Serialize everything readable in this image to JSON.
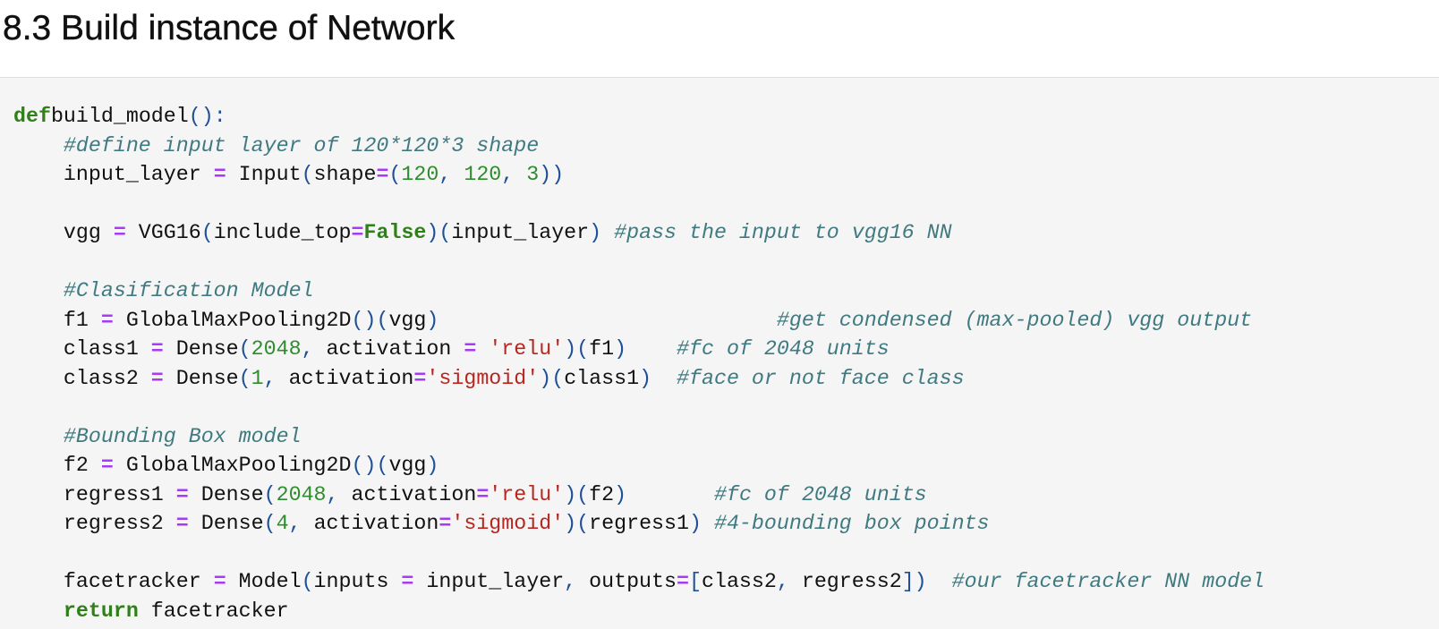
{
  "section": {
    "heading": "8.3 Build instance of Network"
  },
  "code": {
    "lines": [
      [
        [
          "kw",
          "def"
        ],
        [
          "",
          "build_model"
        ],
        [
          "p",
          "():"
        ]
      ],
      [
        [
          "",
          "    "
        ],
        [
          "cm",
          "#define input layer of 120*120*3 shape"
        ]
      ],
      [
        [
          "",
          "    input_layer "
        ],
        [
          "op",
          "="
        ],
        [
          "",
          " Input"
        ],
        [
          "p",
          "("
        ],
        [
          "",
          "shape"
        ],
        [
          "op",
          "="
        ],
        [
          "p",
          "("
        ],
        [
          "num",
          "120"
        ],
        [
          "p",
          ", "
        ],
        [
          "num",
          "120"
        ],
        [
          "p",
          ", "
        ],
        [
          "num",
          "3"
        ],
        [
          "p",
          "))"
        ]
      ],
      [],
      [
        [
          "",
          "    vgg "
        ],
        [
          "op",
          "="
        ],
        [
          "",
          " VGG16"
        ],
        [
          "p",
          "("
        ],
        [
          "",
          "include_top"
        ],
        [
          "op",
          "="
        ],
        [
          "kw",
          "False"
        ],
        [
          "p",
          ")("
        ],
        [
          "",
          "input_layer"
        ],
        [
          "p",
          ")"
        ],
        [
          "",
          " "
        ],
        [
          "cm",
          "#pass the input to vgg16 NN"
        ]
      ],
      [],
      [
        [
          "",
          "    "
        ],
        [
          "cm",
          "#Clasification Model"
        ]
      ],
      [
        [
          "",
          "    f1 "
        ],
        [
          "op",
          "="
        ],
        [
          "",
          " GlobalMaxPooling2D"
        ],
        [
          "p",
          "()("
        ],
        [
          "",
          "vgg"
        ],
        [
          "p",
          ")"
        ],
        [
          "",
          "                           "
        ],
        [
          "cm",
          "#get condensed (max-pooled) vgg output"
        ]
      ],
      [
        [
          "",
          "    class1 "
        ],
        [
          "op",
          "="
        ],
        [
          "",
          " Dense"
        ],
        [
          "p",
          "("
        ],
        [
          "num",
          "2048"
        ],
        [
          "p",
          ", "
        ],
        [
          "",
          "activation "
        ],
        [
          "op",
          "="
        ],
        [
          "",
          " "
        ],
        [
          "str",
          "'relu'"
        ],
        [
          "p",
          ")("
        ],
        [
          "",
          "f1"
        ],
        [
          "p",
          ")"
        ],
        [
          "",
          "    "
        ],
        [
          "cm",
          "#fc of 2048 units"
        ]
      ],
      [
        [
          "",
          "    class2 "
        ],
        [
          "op",
          "="
        ],
        [
          "",
          " Dense"
        ],
        [
          "p",
          "("
        ],
        [
          "num",
          "1"
        ],
        [
          "p",
          ", "
        ],
        [
          "",
          "activation"
        ],
        [
          "op",
          "="
        ],
        [
          "str",
          "'sigmoid'"
        ],
        [
          "p",
          ")("
        ],
        [
          "",
          "class1"
        ],
        [
          "p",
          ")"
        ],
        [
          "",
          "  "
        ],
        [
          "cm",
          "#face or not face class"
        ]
      ],
      [],
      [
        [
          "",
          "    "
        ],
        [
          "cm",
          "#Bounding Box model"
        ]
      ],
      [
        [
          "",
          "    f2 "
        ],
        [
          "op",
          "="
        ],
        [
          "",
          " GlobalMaxPooling2D"
        ],
        [
          "p",
          "()("
        ],
        [
          "",
          "vgg"
        ],
        [
          "p",
          ")"
        ]
      ],
      [
        [
          "",
          "    regress1 "
        ],
        [
          "op",
          "="
        ],
        [
          "",
          " Dense"
        ],
        [
          "p",
          "("
        ],
        [
          "num",
          "2048"
        ],
        [
          "p",
          ", "
        ],
        [
          "",
          "activation"
        ],
        [
          "op",
          "="
        ],
        [
          "str",
          "'relu'"
        ],
        [
          "p",
          ")("
        ],
        [
          "",
          "f2"
        ],
        [
          "p",
          ")"
        ],
        [
          "",
          "       "
        ],
        [
          "cm",
          "#fc of 2048 units"
        ]
      ],
      [
        [
          "",
          "    regress2 "
        ],
        [
          "op",
          "="
        ],
        [
          "",
          " Dense"
        ],
        [
          "p",
          "("
        ],
        [
          "num",
          "4"
        ],
        [
          "p",
          ", "
        ],
        [
          "",
          "activation"
        ],
        [
          "op",
          "="
        ],
        [
          "str",
          "'sigmoid'"
        ],
        [
          "p",
          ")("
        ],
        [
          "",
          "regress1"
        ],
        [
          "p",
          ")"
        ],
        [
          "",
          " "
        ],
        [
          "cm",
          "#4-bounding box points"
        ]
      ],
      [],
      [
        [
          "",
          "    facetracker "
        ],
        [
          "op",
          "="
        ],
        [
          "",
          " Model"
        ],
        [
          "p",
          "("
        ],
        [
          "",
          "inputs "
        ],
        [
          "op",
          "="
        ],
        [
          "",
          " input_layer"
        ],
        [
          "p",
          ", "
        ],
        [
          "",
          "outputs"
        ],
        [
          "op",
          "="
        ],
        [
          "p",
          "["
        ],
        [
          "",
          "class2"
        ],
        [
          "p",
          ", "
        ],
        [
          "",
          "regress2"
        ],
        [
          "p",
          "])"
        ],
        [
          "",
          "  "
        ],
        [
          "cm",
          "#our facetracker NN model"
        ]
      ],
      [
        [
          "",
          "    "
        ],
        [
          "kw",
          "return"
        ],
        [
          "",
          " facetracker"
        ]
      ]
    ]
  }
}
